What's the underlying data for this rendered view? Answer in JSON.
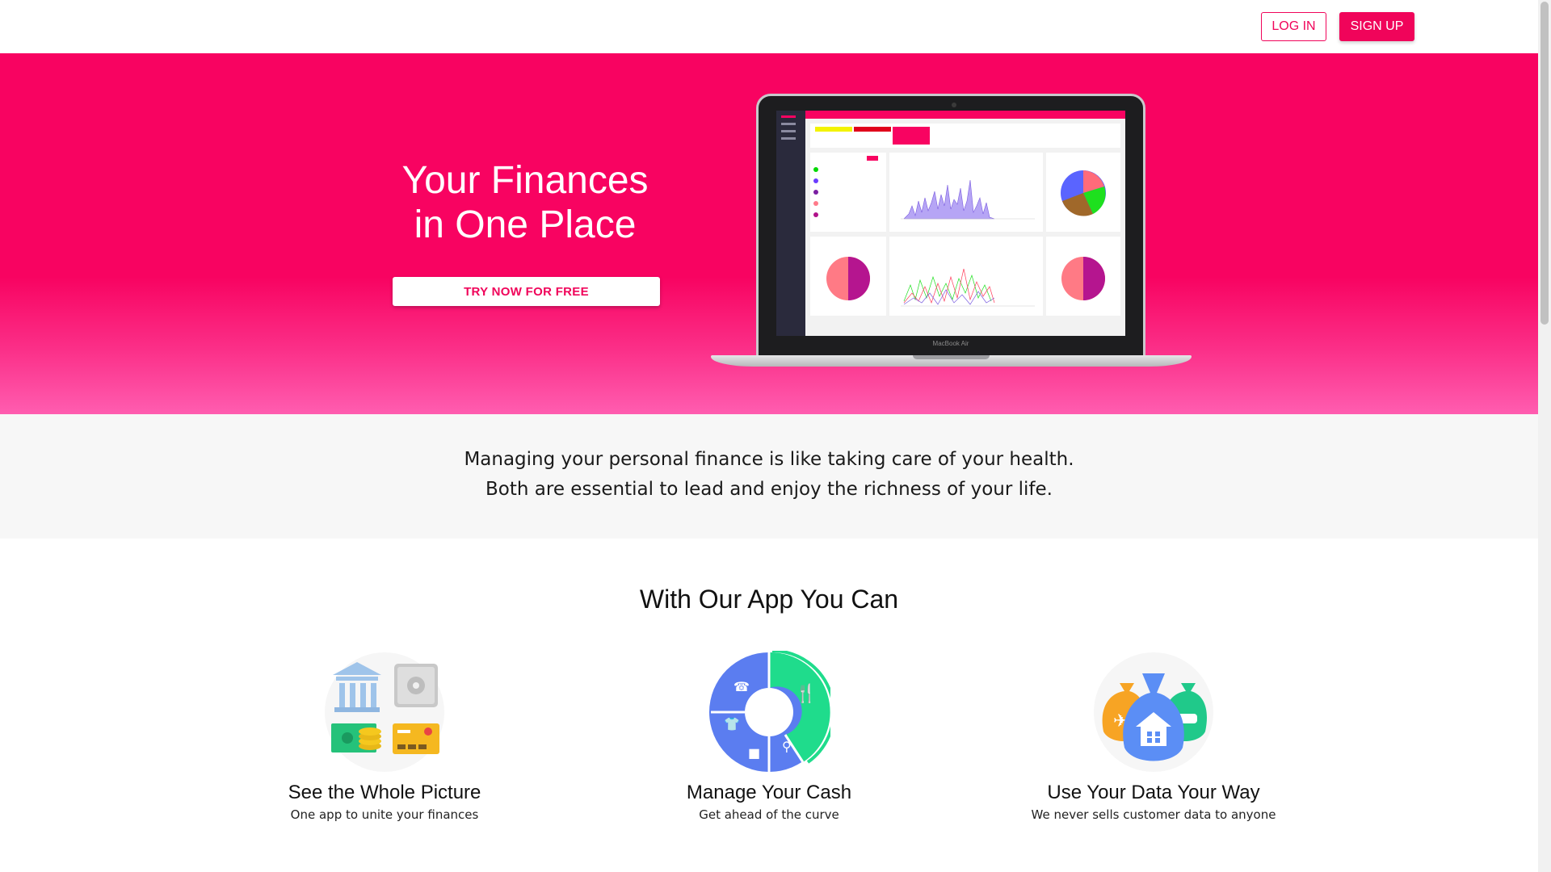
{
  "nav": {
    "login_label": "LOG IN",
    "signup_label": "SIGN UP"
  },
  "hero": {
    "title_line1": "Your Finances",
    "title_line2": "in One Place",
    "cta_label": "TRY NOW FOR FREE",
    "laptop_label": "MacBook Air"
  },
  "quote": {
    "line1": "Managing your personal finance is like taking care of your health.",
    "line2": "Both are essential to lead and enjoy the richness of your life."
  },
  "features": {
    "title": "With Our App You Can",
    "items": [
      {
        "title": "See the Whole Picture",
        "subtitle": "One app to unite your finances",
        "icon": "bank-safe-cash-card-icon"
      },
      {
        "title": "Manage Your Cash",
        "subtitle": "Get ahead of the curve",
        "icon": "spending-donut-icon"
      },
      {
        "title": "Use Your Data Your Way",
        "subtitle": "We never sells customer data to anyone",
        "icon": "money-bags-icon"
      }
    ]
  },
  "colors": {
    "brand_pink": "#f80361",
    "button_pink": "#f0045a"
  }
}
